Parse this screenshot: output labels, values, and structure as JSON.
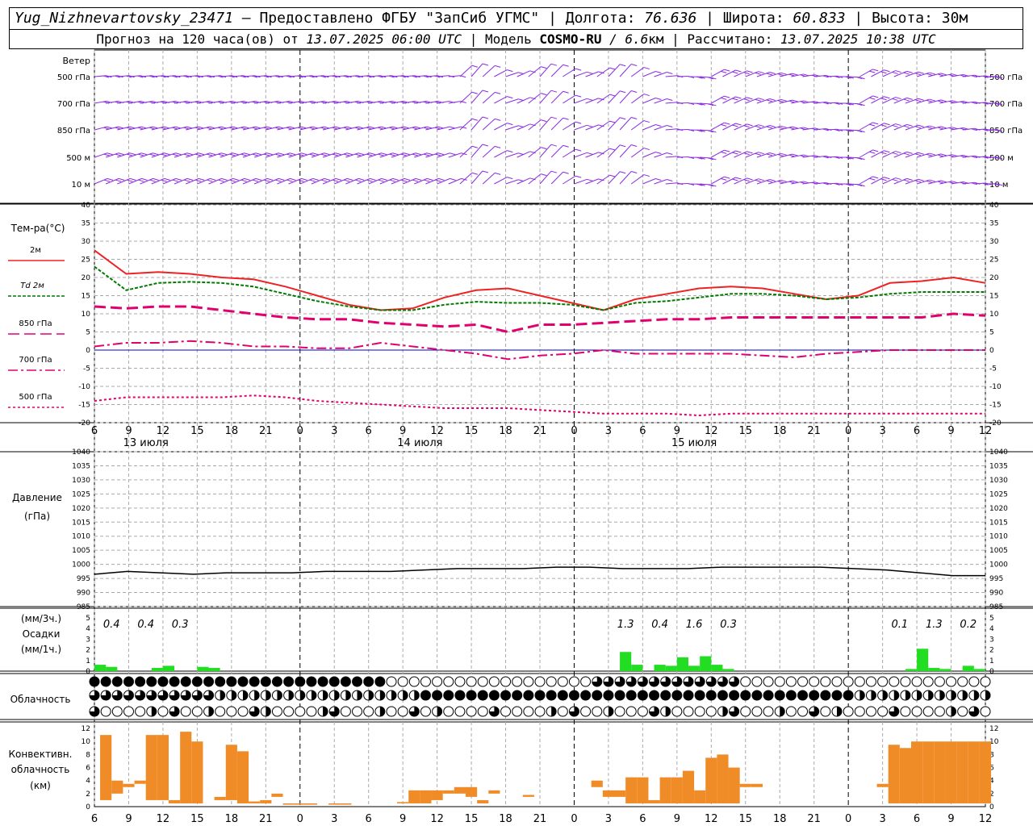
{
  "header": {
    "station": "Yug_Nizhnevartovsky_23471",
    "dash": " – ",
    "provided_by": "Предоставлено ФГБУ \"ЗапСиб УГМС\"",
    "sep": " | ",
    "lon_label": "Долгота: ",
    "lon_value": "76.636",
    "lat_label": "Широта: ",
    "lat_value": "60.833",
    "alt_label": "Высота: ",
    "alt_value": "30м",
    "forecast_prefix": "Прогноз на 120 часа(ов) от ",
    "forecast_time": "13.07.2025 06:00 UTC",
    "model_label": "  | Модель ",
    "model_name": "COSMO-RU",
    "model_res": " / 6.6",
    "model_unit": "км",
    "calc_label": " | Рассчитано: ",
    "calc_time": "13.07.2025 10:38 UTC"
  },
  "labels": {
    "wind_title": "Ветер",
    "wind_levels": [
      "500 гПа",
      "700 гПа",
      "850 гПа",
      "500 м",
      "10 м"
    ],
    "temp_title": "Тем-ра(°C)",
    "temp_legend": [
      "2м",
      "Td 2м",
      "850 гПа",
      "700 гПа",
      "500 гПа"
    ],
    "pressure_title": "Давление",
    "pressure_unit": "(гПа)",
    "precip_unit_3h": "(мм/3ч.)",
    "precip_title": "Осадки",
    "precip_unit_1h": "(мм/1ч.)",
    "cloud_title": "Облачность",
    "conv_title_1": "Конвективн.",
    "conv_title_2": "облачность",
    "conv_unit": "(км)"
  },
  "time_axis": {
    "tick_labels": [
      "6",
      "9",
      "12",
      "15",
      "18",
      "21",
      "0",
      "3",
      "6",
      "9",
      "12",
      "15",
      "18",
      "21",
      "0",
      "3",
      "6",
      "9",
      "12",
      "15",
      "18",
      "21",
      "0",
      "3",
      "6",
      "9",
      "12"
    ],
    "day_labels": [
      "13 июля",
      "14 июля",
      "15 июля"
    ]
  },
  "colors": {
    "wind": "#8a2be2",
    "t2m": "#ee2222",
    "td2m": "#007a00",
    "t850": "#e0006e",
    "t700": "#e0006e",
    "t500": "#e0006e",
    "zero_line": "#0000cc",
    "pressure": "#000000",
    "precip": "#22dd22",
    "convective": "#f08c28",
    "grid": "#aaaaaa"
  },
  "chart_data": [
    {
      "type": "line",
      "name": "temperature",
      "ylim": [
        -20,
        40
      ],
      "yticks": [
        40,
        35,
        30,
        25,
        20,
        15,
        10,
        5,
        0,
        -5,
        -10,
        -15,
        -20
      ],
      "x_hours": [
        0,
        3,
        6,
        9,
        12,
        15,
        18,
        21,
        24,
        27,
        30,
        33,
        36,
        39,
        42,
        45,
        48,
        51,
        54,
        57,
        60,
        63,
        66,
        69,
        72,
        75,
        78
      ],
      "series": [
        {
          "name": "2м",
          "values": [
            27.5,
            21,
            21.5,
            21,
            20,
            19.5,
            17.5,
            15,
            12.5,
            11,
            11.5,
            14.5,
            16.5,
            17,
            15,
            13,
            11,
            14,
            15.5,
            17,
            17.5,
            17,
            15.5,
            14,
            15,
            18.5,
            19,
            20,
            18.5
          ]
        },
        {
          "name": "Td 2м",
          "values": [
            23,
            16.5,
            18.5,
            18.8,
            18.5,
            17.5,
            15.5,
            13.5,
            12,
            11,
            11,
            12.5,
            13.3,
            13,
            13,
            12.5,
            11,
            13,
            13.5,
            14.5,
            15.5,
            15.5,
            15,
            14,
            14.5,
            15.5,
            16,
            16,
            16
          ]
        },
        {
          "name": "850 гПа",
          "values": [
            12,
            11.5,
            12,
            12,
            11,
            10,
            9,
            8.5,
            8.5,
            7.5,
            7,
            6.5,
            7,
            5,
            7,
            7,
            7.5,
            8,
            8.5,
            8.5,
            9,
            9,
            9,
            9,
            9,
            9,
            9,
            10,
            9.5
          ]
        },
        {
          "name": "700 гПа",
          "values": [
            1,
            2,
            2,
            2.5,
            2,
            1,
            1,
            0.5,
            0.5,
            2,
            1,
            0,
            -1,
            -2.5,
            -1.5,
            -1,
            0,
            -1,
            -1,
            -1,
            -1,
            -1.5,
            -2,
            -1,
            -0.5,
            0,
            0,
            0,
            0
          ]
        },
        {
          "name": "500 гПа",
          "values": [
            -14,
            -13,
            -13,
            -13,
            -13,
            -12.5,
            -13,
            -14,
            -14.5,
            -15,
            -15.5,
            -16,
            -16,
            -16,
            -16.5,
            -17,
            -17.5,
            -17.5,
            -17.5,
            -18,
            -17.5,
            -17.5,
            -17.5,
            -17.5,
            -17.5,
            -17.5,
            -17.5,
            -17.5,
            -17.5
          ]
        }
      ]
    },
    {
      "type": "line",
      "name": "pressure",
      "ylim": [
        985,
        1040
      ],
      "yticks": [
        1040,
        1035,
        1030,
        1025,
        1020,
        1015,
        1010,
        1005,
        1000,
        995,
        990,
        985
      ],
      "values": [
        996.5,
        997.5,
        997,
        996.5,
        997,
        997,
        997,
        997.5,
        997.5,
        997.5,
        998,
        998.5,
        998.5,
        998.5,
        999,
        999,
        998.5,
        998.5,
        998.5,
        999,
        999,
        999,
        999,
        998.5,
        998,
        997,
        996,
        996
      ]
    },
    {
      "type": "bar",
      "name": "precipitation",
      "ylim": [
        0,
        5
      ],
      "yticks": [
        5,
        4,
        3,
        2,
        1,
        0
      ],
      "values_1h": [
        0.6,
        0.4,
        0,
        0,
        0,
        0.3,
        0.5,
        0,
        0,
        0.4,
        0.3,
        0,
        0,
        0,
        0,
        0,
        0,
        0,
        0,
        0,
        0,
        0,
        0,
        0,
        0,
        0,
        0,
        0,
        0,
        0,
        0,
        0,
        0,
        0,
        0,
        0,
        0,
        0,
        0,
        0,
        0,
        0,
        0,
        0,
        0,
        0,
        0,
        0,
        0,
        0,
        0,
        0,
        0,
        0,
        0,
        0,
        0,
        0,
        0,
        0,
        0,
        0,
        0,
        0,
        0,
        0,
        0,
        0,
        0,
        0,
        0,
        0,
        0,
        0,
        0,
        0,
        0,
        0,
        0,
        0,
        0,
        0,
        0,
        0,
        0,
        0,
        0,
        0,
        0,
        0,
        0,
        0,
        0,
        0,
        0,
        0,
        0,
        0,
        0,
        0,
        0,
        0,
        0,
        0,
        0,
        0,
        0,
        0,
        0,
        0,
        0,
        0,
        0,
        0,
        0,
        0,
        0,
        0,
        0,
        0,
        0,
        0,
        0,
        0,
        0,
        0,
        0,
        0,
        0,
        0,
        0,
        0,
        0,
        0,
        0,
        0,
        0,
        0,
        0,
        0,
        0,
        0,
        0,
        0,
        0,
        0,
        0,
        0,
        0,
        0,
        0,
        0,
        0,
        0,
        0,
        0,
        0,
        0,
        0,
        0,
        0,
        0,
        0,
        0,
        0,
        0,
        0,
        0,
        0,
        0,
        0,
        0,
        0,
        0,
        0,
        0,
        0,
        0,
        0,
        0,
        0,
        0,
        0,
        0,
        0,
        0,
        0,
        0,
        0,
        0,
        0,
        0,
        0,
        0,
        0,
        0,
        0,
        0,
        0,
        0,
        0,
        0,
        0,
        0,
        0,
        0,
        0,
        0,
        0,
        0,
        0,
        0,
        0,
        0,
        0,
        0,
        0,
        0,
        0,
        0,
        0,
        0,
        0,
        0,
        0,
        0,
        0,
        0,
        0,
        0,
        0,
        0,
        0,
        0,
        0,
        0,
        0,
        0,
        0,
        0,
        0,
        0,
        0,
        0,
        0,
        0,
        0,
        0,
        0,
        0,
        0,
        0,
        0,
        0,
        0,
        0,
        0,
        0,
        0,
        0,
        0,
        0,
        0,
        0,
        0,
        0,
        0,
        0,
        0,
        0,
        0,
        0,
        0,
        0,
        0,
        0,
        0
      ],
      "bars": [
        {
          "h": 0.5,
          "v": 0.6
        },
        {
          "h": 1.5,
          "v": 0.4
        },
        {
          "h": 5.5,
          "v": 0.3
        },
        {
          "h": 6.5,
          "v": 0.5
        },
        {
          "h": 9.5,
          "v": 0.4
        },
        {
          "h": 10.5,
          "v": 0.3
        },
        {
          "h": 46.5,
          "v": 1.8
        },
        {
          "h": 47.5,
          "v": 0.6
        },
        {
          "h": 49.5,
          "v": 0.6
        },
        {
          "h": 50.5,
          "v": 0.5
        },
        {
          "h": 51.5,
          "v": 1.3
        },
        {
          "h": 52.5,
          "v": 0.5
        },
        {
          "h": 53.5,
          "v": 1.4
        },
        {
          "h": 54.5,
          "v": 0.6
        },
        {
          "h": 55.5,
          "v": 0.2
        },
        {
          "h": 71.5,
          "v": 0.2
        },
        {
          "h": 72.5,
          "v": 2.1
        },
        {
          "h": 73.5,
          "v": 0.3
        },
        {
          "h": 74.5,
          "v": 0.2
        },
        {
          "h": 76.5,
          "v": 0.5
        },
        {
          "h": 77.5,
          "v": 0.2
        }
      ],
      "totals_3h": [
        {
          "h": 1.5,
          "label": "0.4"
        },
        {
          "h": 4.5,
          "label": "0.4"
        },
        {
          "h": 7.5,
          "label": "0.3"
        },
        {
          "h": 46.5,
          "label": "1.3"
        },
        {
          "h": 49.5,
          "label": "0.4"
        },
        {
          "h": 52.5,
          "label": "1.6"
        },
        {
          "h": 55.5,
          "label": "0.3"
        },
        {
          "h": 70.5,
          "label": "0.1"
        },
        {
          "h": 73.5,
          "label": "1.3"
        },
        {
          "h": 76.5,
          "label": "0.2"
        }
      ]
    },
    {
      "type": "bar",
      "name": "convective_cloud",
      "ylim": [
        0,
        13
      ],
      "yticks": [
        12,
        10,
        8,
        6,
        4,
        2,
        0
      ],
      "bars": [
        {
          "h": 1,
          "bottom": 1,
          "top": 11
        },
        {
          "h": 2,
          "bottom": 2,
          "top": 4
        },
        {
          "h": 3,
          "bottom": 3,
          "top": 3.5
        },
        {
          "h": 4,
          "bottom": 3.5,
          "top": 4
        },
        {
          "h": 5,
          "bottom": 1,
          "top": 11
        },
        {
          "h": 6,
          "bottom": 1,
          "top": 11
        },
        {
          "h": 7,
          "bottom": 0.5,
          "top": 1
        },
        {
          "h": 8,
          "bottom": 0.5,
          "top": 11.5
        },
        {
          "h": 9,
          "bottom": 0.5,
          "top": 10
        },
        {
          "h": 11,
          "bottom": 1,
          "top": 1.5
        },
        {
          "h": 12,
          "bottom": 1,
          "top": 9.5
        },
        {
          "h": 13,
          "bottom": 0.5,
          "top": 8.5
        },
        {
          "h": 14,
          "bottom": 0.5,
          "top": 0.8
        },
        {
          "h": 15,
          "bottom": 0.5,
          "top": 1
        },
        {
          "h": 16,
          "bottom": 1.5,
          "top": 2
        },
        {
          "h": 17,
          "bottom": 0.3,
          "top": 0.5
        },
        {
          "h": 18,
          "bottom": 0.3,
          "top": 0.5
        },
        {
          "h": 19,
          "bottom": 0.3,
          "top": 0.5
        },
        {
          "h": 21,
          "bottom": 0.3,
          "top": 0.5
        },
        {
          "h": 22,
          "bottom": 0.3,
          "top": 0.5
        },
        {
          "h": 27,
          "bottom": 0.5,
          "top": 0.7
        },
        {
          "h": 28,
          "bottom": 0.5,
          "top": 2.5
        },
        {
          "h": 29,
          "bottom": 0.5,
          "top": 2.5
        },
        {
          "h": 30,
          "bottom": 1,
          "top": 2.5
        },
        {
          "h": 31,
          "bottom": 2,
          "top": 2.5
        },
        {
          "h": 32,
          "bottom": 2,
          "top": 3
        },
        {
          "h": 33,
          "bottom": 1.5,
          "top": 3
        },
        {
          "h": 34,
          "bottom": 0.5,
          "top": 1
        },
        {
          "h": 35,
          "bottom": 2,
          "top": 2.5
        },
        {
          "h": 38,
          "bottom": 1.5,
          "top": 1.8
        },
        {
          "h": 44,
          "bottom": 3,
          "top": 4
        },
        {
          "h": 45,
          "bottom": 1.5,
          "top": 2.5
        },
        {
          "h": 46,
          "bottom": 1.5,
          "top": 2.5
        },
        {
          "h": 47,
          "bottom": 0.5,
          "top": 4.5
        },
        {
          "h": 48,
          "bottom": 0.5,
          "top": 4.5
        },
        {
          "h": 49,
          "bottom": 0.5,
          "top": 1
        },
        {
          "h": 50,
          "bottom": 0.5,
          "top": 4.5
        },
        {
          "h": 51,
          "bottom": 0.5,
          "top": 4.5
        },
        {
          "h": 52,
          "bottom": 0.5,
          "top": 5.5
        },
        {
          "h": 53,
          "bottom": 0.5,
          "top": 2.5
        },
        {
          "h": 54,
          "bottom": 0.5,
          "top": 7.5
        },
        {
          "h": 55,
          "bottom": 0.5,
          "top": 8
        },
        {
          "h": 56,
          "bottom": 0.5,
          "top": 6
        },
        {
          "h": 57,
          "bottom": 3,
          "top": 3.5
        },
        {
          "h": 58,
          "bottom": 3,
          "top": 3.5
        },
        {
          "h": 69,
          "bottom": 3,
          "top": 3.5
        },
        {
          "h": 70,
          "bottom": 0.5,
          "top": 9.5
        },
        {
          "h": 71,
          "bottom": 0.5,
          "top": 9
        },
        {
          "h": 72,
          "bottom": 0.5,
          "top": 10
        },
        {
          "h": 73,
          "bottom": 0.5,
          "top": 10
        },
        {
          "h": 74,
          "bottom": 0.5,
          "top": 10
        },
        {
          "h": 75,
          "bottom": 0.5,
          "top": 10
        },
        {
          "h": 76,
          "bottom": 0.5,
          "top": 10
        },
        {
          "h": 77,
          "bottom": 0.5,
          "top": 10
        },
        {
          "h": 78,
          "bottom": 0.5,
          "top": 10
        }
      ]
    }
  ]
}
